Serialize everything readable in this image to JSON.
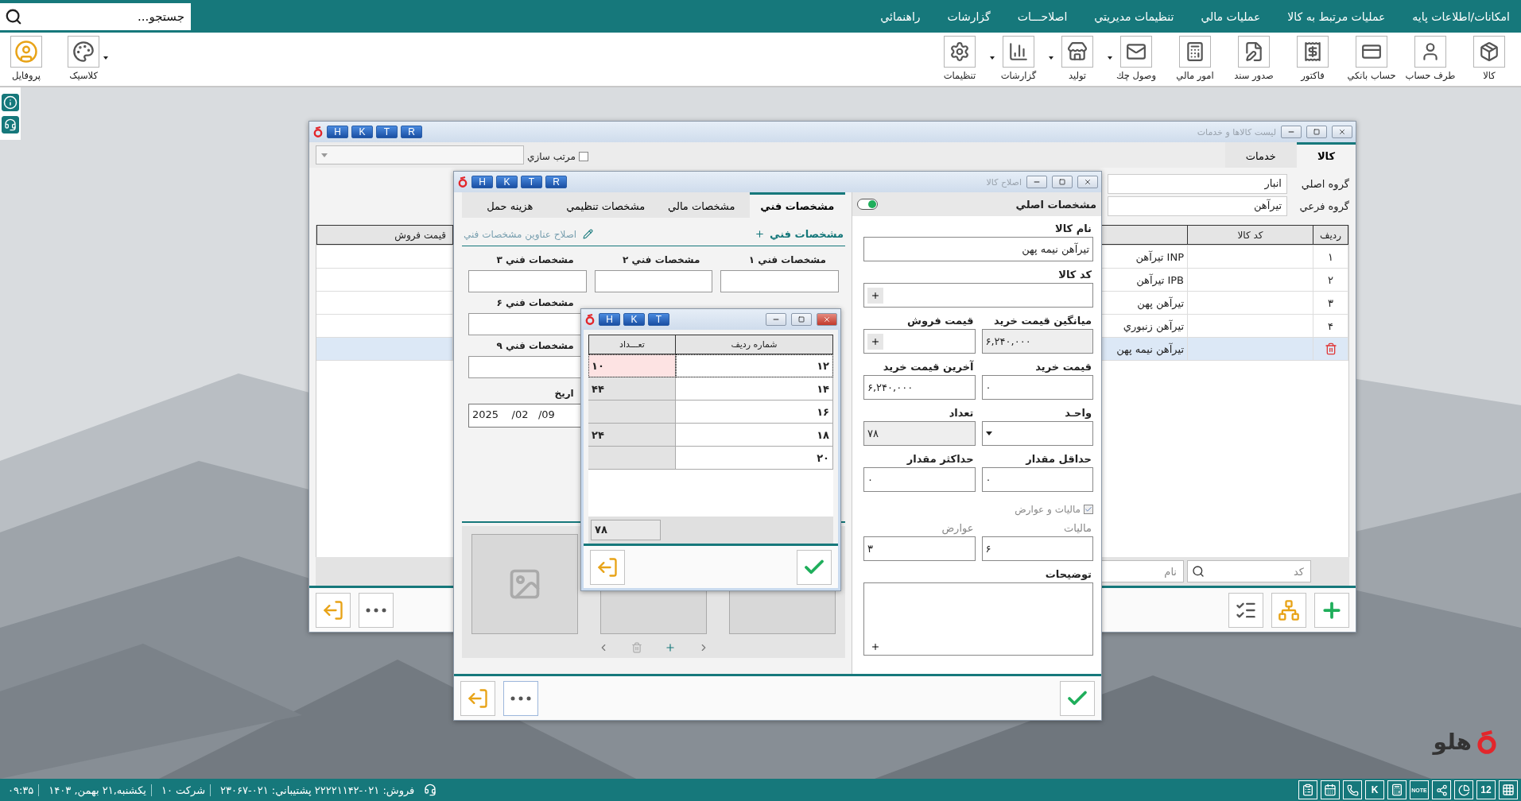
{
  "menu": {
    "search": {
      "placeholder": "جستجو..."
    },
    "items": [
      "امکانات/اطلاعات پایه",
      "عملیات مرتبط به کالا",
      "عملیات مالي",
      "تنظیمات مدیریتي",
      "اصلاحـــات",
      "گزارشات",
      "راهنمائي"
    ]
  },
  "toolbar": {
    "items": [
      {
        "label": "کالا",
        "dropdown": false
      },
      {
        "label": "طرف حساب",
        "dropdown": false
      },
      {
        "label": "حساب بانکي",
        "dropdown": false
      },
      {
        "label": "فاکتور",
        "dropdown": false
      },
      {
        "label": "صدور سند",
        "dropdown": false
      },
      {
        "label": "امور مالي",
        "dropdown": false
      },
      {
        "label": "وصول چك",
        "dropdown": true
      },
      {
        "label": "تولید",
        "dropdown": true
      },
      {
        "label": "گزارشات",
        "dropdown": true
      },
      {
        "label": "تنظیمات",
        "dropdown": false
      }
    ],
    "left_items": [
      {
        "label": "کلاسیک",
        "dropdown": true
      },
      {
        "label": "پروفایل",
        "dropdown": false
      }
    ]
  },
  "items_window": {
    "title": "لیست کالاها و خدمات",
    "shortcut_keys": [
      "R",
      "T",
      "K",
      "H"
    ],
    "tabs": [
      {
        "label": "کالا",
        "selected": true
      },
      {
        "label": "خدمات",
        "selected": false
      }
    ],
    "sort_checkbox": {
      "label": "مرتب سازي",
      "checked": false
    },
    "groups": [
      {
        "label": "گروه اصلي",
        "value": "انبار"
      },
      {
        "label": "گروه فرعي",
        "value": "تیرآهن"
      }
    ],
    "columns": [
      "ردیف",
      "کد کالا",
      "قیمت فروش"
    ],
    "rows": [
      {
        "row": "۱",
        "name": "تیرآهن INP",
        "selected": false
      },
      {
        "row": "۲",
        "name": "تیرآهن IPB",
        "selected": false
      },
      {
        "row": "۳",
        "name": "تیرآهن پهن",
        "selected": false
      },
      {
        "row": "۴",
        "name": "تیرآهن زنبوري",
        "selected": false
      },
      {
        "name": "تیرآهن نیمه پهن",
        "selected": true
      }
    ],
    "search": {
      "code_placeholder": "کد",
      "name_placeholder": "نام"
    }
  },
  "edit_window": {
    "title": "اصلاح کالا",
    "shortcut_keys": [
      "R",
      "T",
      "K",
      "H"
    ],
    "main": {
      "title": "مشخصات اصلي",
      "toggle_on": true,
      "rows": [
        [
          {
            "kind": "text",
            "label": "نام کالا",
            "value": "تیرآهن نیمه پهن",
            "readonly": false,
            "disabled": false
          }
        ],
        [
          {
            "kind": "plus",
            "label": "کد کالا",
            "readonly": false,
            "disabled": false
          }
        ],
        [
          {
            "kind": "number",
            "label": "میانگین قیمت خرید",
            "value": "۶,۲۴۰,۰۰۰",
            "readonly": true,
            "disabled": false
          },
          {
            "kind": "plus",
            "label": "قیمت فروش",
            "readonly": false,
            "disabled": false
          }
        ],
        [
          {
            "kind": "number",
            "label": "قیمت خرید",
            "value": "۰",
            "readonly": false,
            "disabled": false
          },
          {
            "kind": "number",
            "label": "آخرین قیمت خرید",
            "value": "۶,۲۴۰,۰۰۰",
            "readonly": false,
            "disabled": false
          }
        ],
        [
          {
            "kind": "select",
            "label": "واحـد",
            "readonly": false,
            "disabled": false
          },
          {
            "kind": "number",
            "label": "تعداد",
            "value": "۷۸",
            "readonly": true,
            "disabled": false
          }
        ],
        [
          {
            "kind": "number",
            "label": "حداقل مقدار",
            "value": "۰",
            "readonly": false,
            "disabled": false
          },
          {
            "kind": "number",
            "label": "حداکثر مقدار",
            "value": "۰",
            "readonly": false,
            "disabled": false
          }
        ],
        [
          {
            "kind": "checkbox",
            "label": "مالیات و عوارض",
            "checked": true,
            "disabled": true
          }
        ],
        [
          {
            "kind": "number",
            "label": "مالیات",
            "value": "۶",
            "readonly": false,
            "disabled": true
          },
          {
            "kind": "number",
            "label": "عوارض",
            "value": "۳",
            "readonly": false,
            "disabled": true
          }
        ],
        [
          {
            "kind": "textarea",
            "label": "توضیحات",
            "readonly": false,
            "disabled": false
          }
        ]
      ]
    },
    "tabs": [
      {
        "label": "مشخصات فني",
        "selected": true
      },
      {
        "label": "مشخصات مالي",
        "selected": false
      },
      {
        "label": "مشخصات تنظیمي",
        "selected": false
      },
      {
        "label": "هزینه حمل",
        "selected": false
      }
    ],
    "specs": {
      "add_link": "مشخصات فني",
      "edit_link": "اصلاح عناوین مشخصات فني",
      "rows": [
        [
          "مشخصات فني ۱",
          "مشخصات فني ۲",
          "مشخصات فني ۳"
        ],
        [
          "مشخصات فني ۶"
        ],
        [
          "مشخصات فني ۹"
        ]
      ],
      "date": {
        "label": "اریخ",
        "value": "2025    /02   /09"
      }
    }
  },
  "quantity_dialog": {
    "shortcut_keys": [
      "T",
      "K",
      "H"
    ],
    "columns": [
      "شماره ردیف",
      "تعـــداد"
    ],
    "rows": [
      {
        "number": "۱۲",
        "quantity": "۱۰",
        "selected": true
      },
      {
        "number": "۱۴",
        "quantity": "۴۴",
        "selected": false
      },
      {
        "number": "۱۶",
        "selected": false
      },
      {
        "number": "۱۸",
        "quantity": "۲۴",
        "selected": false
      },
      {
        "number": "۲۰",
        "selected": false
      }
    ],
    "total": "۷۸"
  },
  "brand": "هلو",
  "status_bar": {
    "time": "۰۹:۳۵",
    "date": "یکشنبه,۲۱ بهمن, ۱۴۰۳",
    "company": "شرکت ۱۰",
    "contacts": "فروش: ۰۲۱-۲۲۲۲۱۱۴۲ پشتیباني: ۰۲۱-۲۳۰۶۷",
    "tray": [
      {
        "kind": "grid"
      },
      {
        "kind": "day",
        "label": "12"
      },
      {
        "kind": "chart"
      },
      {
        "kind": "share"
      },
      {
        "kind": "note",
        "label": "NOTE"
      },
      {
        "kind": "calculator"
      },
      {
        "kind": "key",
        "label": "K"
      },
      {
        "kind": "phone"
      },
      {
        "kind": "calendar"
      },
      {
        "kind": "clipboard"
      }
    ]
  }
}
